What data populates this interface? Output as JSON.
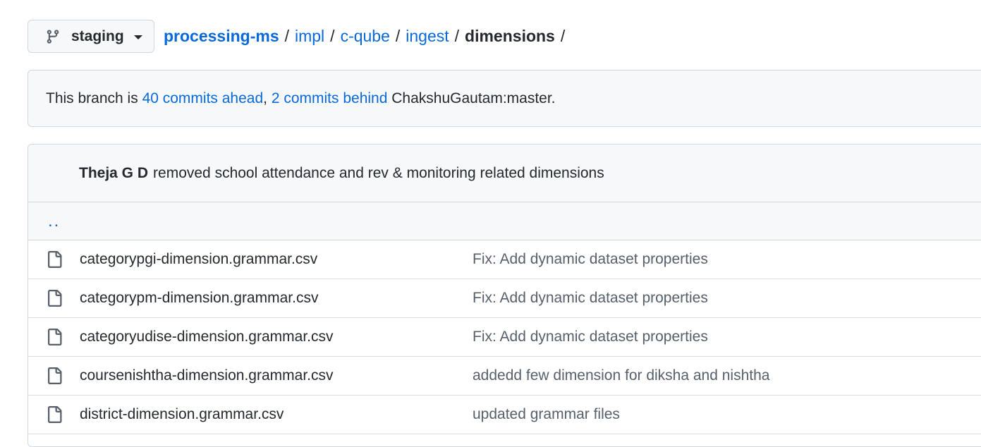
{
  "branch": {
    "label": "staging",
    "icon": "git-branch-icon"
  },
  "breadcrumb": {
    "repo": "processing-ms",
    "segments": [
      "impl",
      "c-qube",
      "ingest"
    ],
    "current": "dimensions",
    "separator": "/"
  },
  "notice": {
    "prefix": "This branch is ",
    "ahead": "40 commits ahead",
    "comma": ", ",
    "behind": "2 commits behind",
    "suffix": " ChakshuGautam:master."
  },
  "latest_commit": {
    "author": "Theja G D",
    "message": "removed school attendance and rev & monitoring related dimensions"
  },
  "parent_dir": "..",
  "files": [
    {
      "name": "categorypgi-dimension.grammar.csv",
      "message": "Fix: Add dynamic dataset properties",
      "icon": "file-icon"
    },
    {
      "name": "categorypm-dimension.grammar.csv",
      "message": "Fix: Add dynamic dataset properties",
      "icon": "file-icon"
    },
    {
      "name": "categoryudise-dimension.grammar.csv",
      "message": "Fix: Add dynamic dataset properties",
      "icon": "file-icon"
    },
    {
      "name": "coursenishtha-dimension.grammar.csv",
      "message": "addedd few dimension for diksha and nishtha",
      "icon": "file-icon"
    },
    {
      "name": "district-dimension.grammar.csv",
      "message": "updated grammar files",
      "icon": "file-icon"
    }
  ],
  "colors": {
    "link": "#0969da",
    "muted": "#57606a",
    "border": "#d0d7de",
    "subtle_bg": "#f6f8fa"
  }
}
